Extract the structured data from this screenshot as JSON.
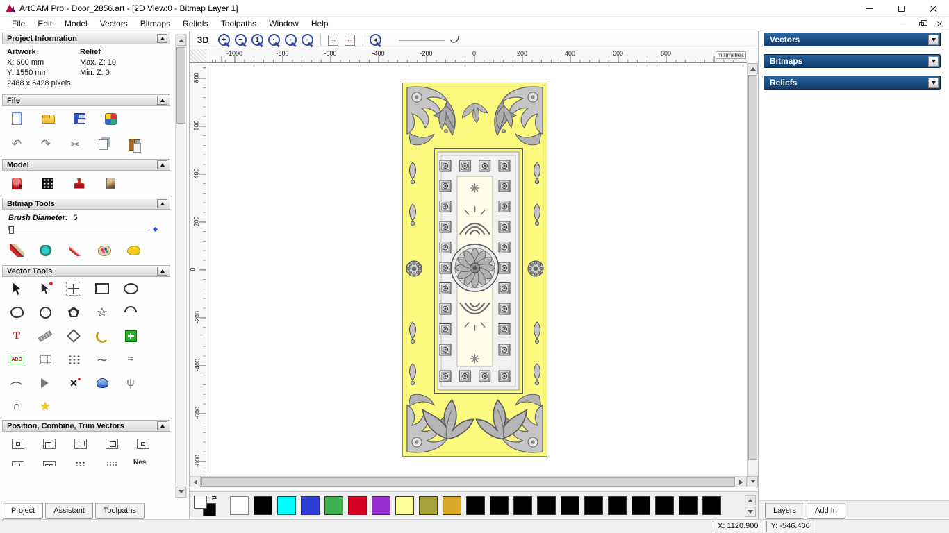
{
  "window": {
    "title": "ArtCAM Pro - Door_2856.art - [2D View:0 - Bitmap Layer 1]"
  },
  "menu": {
    "items": [
      "File",
      "Edit",
      "Model",
      "Vectors",
      "Bitmaps",
      "Reliefs",
      "Toolpaths",
      "Window",
      "Help"
    ]
  },
  "left_panel": {
    "project_information": {
      "title": "Project Information",
      "artwork_label": "Artwork",
      "relief_label": "Relief",
      "x": "X: 600 mm",
      "y": "Y: 1550 mm",
      "pixels": "2488 x 6428 pixels",
      "max_z": "Max. Z: 10",
      "min_z": "Min. Z: 0"
    },
    "file": {
      "title": "File",
      "icons_row1": [
        "new-document",
        "open-file",
        "save-file",
        "import-model"
      ],
      "icons_row2": [
        "undo",
        "redo",
        "cut",
        "copy",
        "paste"
      ]
    },
    "model": {
      "title": "Model",
      "icons": [
        "relief-clipart",
        "texture-relief",
        "stamp-tool",
        "load-image"
      ]
    },
    "bitmap_tools": {
      "title": "Bitmap Tools",
      "brush_label": "Brush Diameter:",
      "brush_value": "5",
      "icons": [
        "paint-brush",
        "flood-fill",
        "draw-pencil",
        "colour-palette",
        "paint-selected"
      ]
    },
    "vector_tools": {
      "title": "Vector Tools",
      "rows": [
        [
          "select-vectors",
          "node-editing",
          "transform-vectors",
          "create-rectangle",
          "create-ellipse"
        ],
        [
          "free-shape",
          "create-circle",
          "create-polygon",
          "create-star",
          "create-arc"
        ],
        [
          "create-text",
          "measure-tool",
          "offset-vector",
          "fillet-tool",
          "block-paste"
        ],
        [
          "text-on-curve",
          "grid-copy",
          "nesting-dots",
          "fit-curve",
          "fit-polyline"
        ],
        [
          "arc-fit",
          "vector-doctor",
          "trim-vectors",
          "interactive-distort",
          "fit-tree"
        ],
        [
          "close-vector",
          "sculpt-star"
        ]
      ]
    },
    "position_combine": {
      "title": "Position, Combine, Trim Vectors",
      "rows": [
        [
          "center-in-page",
          "align-left-edge",
          "align-top-edge",
          "align-bottom-edge",
          "align-centers"
        ],
        [
          "align-bottom2",
          "align-spread",
          "stack-dots",
          "scatter-dots"
        ]
      ],
      "nesting_text": "Nes"
    },
    "tabs": [
      {
        "label": "Project",
        "active": true
      },
      {
        "label": "Assistant",
        "active": false
      },
      {
        "label": "Toolpaths",
        "active": false
      }
    ]
  },
  "canvas": {
    "toolbar": {
      "button_3d": "3D",
      "zoom_icons": [
        "zoom-in",
        "zoom-out",
        "zoom-scale",
        "zoom-objects",
        "zoom-window",
        "zoom-drawing"
      ],
      "snap_icons": [
        "snap-right",
        "snap-left"
      ],
      "nav_icons": [
        "zoom-previous"
      ]
    },
    "ruler": {
      "h_labels": [
        "-1000",
        "-800",
        "-600",
        "-400",
        "-200",
        "0",
        "200",
        "400",
        "600",
        "800"
      ],
      "v_labels": [
        "800",
        "600",
        "400",
        "200",
        "0",
        "-200",
        "-400",
        "-600",
        "-800"
      ],
      "units": "millimetres"
    }
  },
  "door": {
    "background": "#fbfa7e",
    "ornament_light": "#d9d9d9",
    "ornament_mid": "#a8a8a8",
    "ornament_dark": "#5f5f5f"
  },
  "palette": {
    "foreground": "#ffffff",
    "background": "#000000",
    "swatches": [
      "#ffffff",
      "#000000",
      "#00ffff",
      "#2c3ed6",
      "#3fae4e",
      "#d50022",
      "#9a2fd0",
      "#ffffa0",
      "#a8a23b",
      "#d9a827",
      "#000000",
      "#000000",
      "#000000",
      "#000000",
      "#000000",
      "#000000",
      "#000000",
      "#000000",
      "#000000",
      "#000000",
      "#000000"
    ]
  },
  "right_panel": {
    "sections": [
      {
        "label": "Vectors"
      },
      {
        "label": "Bitmaps"
      },
      {
        "label": "Reliefs"
      }
    ],
    "tabs": [
      {
        "label": "Layers",
        "active": false
      },
      {
        "label": "Add In",
        "active": true
      }
    ]
  },
  "status": {
    "x": "X: 1120.900",
    "y": "Y: -546.406"
  }
}
